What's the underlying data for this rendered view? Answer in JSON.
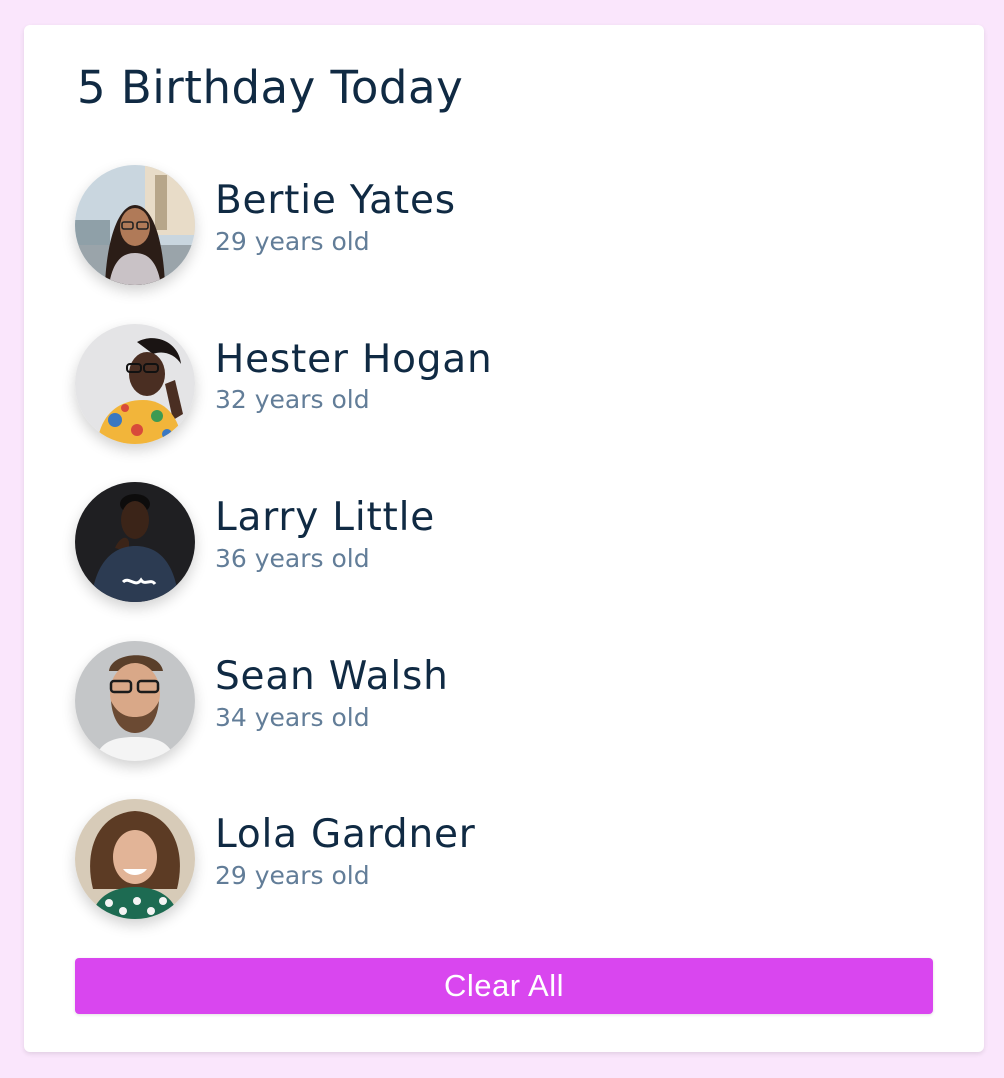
{
  "header": {
    "title": "5 Birthday Today"
  },
  "people": [
    {
      "name": "Bertie Yates",
      "age": "29 years old"
    },
    {
      "name": "Hester Hogan",
      "age": "32 years old"
    },
    {
      "name": "Larry Little",
      "age": "36 years old"
    },
    {
      "name": "Sean Walsh",
      "age": "34 years old"
    },
    {
      "name": "Lola Gardner",
      "age": "29 years old"
    }
  ],
  "actions": {
    "clear_label": "Clear All"
  },
  "colors": {
    "page_background": "#fae6fc",
    "card_background": "#ffffff",
    "accent": "#d946ef",
    "name_text": "#102a43",
    "age_text": "#627d98"
  }
}
